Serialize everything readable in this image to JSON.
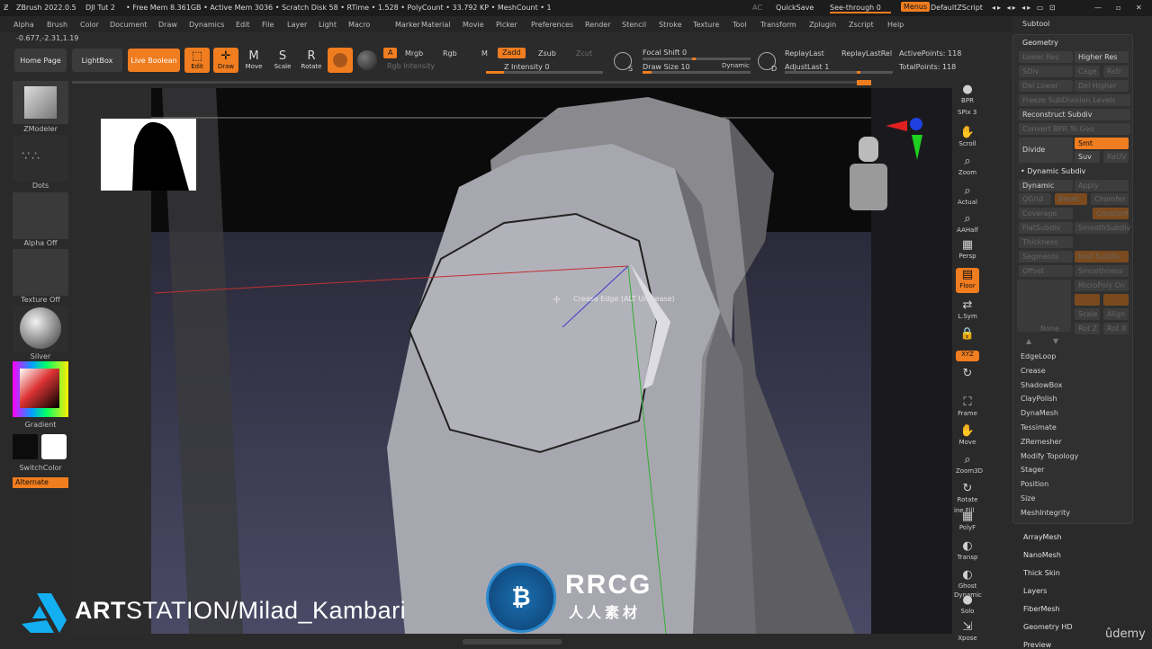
{
  "titlebar": {
    "app": "ZBrush 2022.0.5",
    "doc": "DJI Tut 2",
    "stats": "• Free Mem 8.361GB • Active Mem 3036 • Scratch Disk 58 • RTime • 1.528 • PolyCount • 33.792 KP • MeshCount • 1",
    "ac": "AC",
    "quicksave": "QuickSave",
    "seethrough": "See-through  0",
    "menus": "Menus",
    "script": "DefaultZScript"
  },
  "menubar": [
    "Alpha",
    "Brush",
    "Color",
    "Document",
    "Draw",
    "Dynamics",
    "Edit",
    "File",
    "Layer",
    "Light",
    "Macro",
    "Marker",
    "Material",
    "Movie",
    "Picker",
    "Preferences",
    "Render",
    "Stencil",
    "Stroke",
    "Texture",
    "Tool",
    "Transform",
    "Zplugin",
    "Zscript",
    "Help"
  ],
  "coords": "-0.677,-2.31,1.19",
  "toolbar": {
    "home": "Home Page",
    "lightbox": "LightBox",
    "liveboolean": "Live Boolean",
    "edit": "Edit",
    "draw": "Draw",
    "move": "Move",
    "scale": "Scale",
    "rotate": "Rotate",
    "a": "A",
    "mrgb": "Mrgb",
    "rgb": "Rgb",
    "m": "M",
    "zadd": "Zadd",
    "zsub": "Zsub",
    "zcut": "Zcut",
    "rgb_intensity": "Rgb Intensity",
    "z_intensity": "Z Intensity 0",
    "focal_shift": "Focal Shift 0",
    "draw_size": "Draw Size 10",
    "dynamic": "Dynamic",
    "replaylast": "ReplayLast",
    "replaylastrel": "ReplayLastRel",
    "adjustlast": "AdjustLast 1",
    "activepoints": "ActivePoints: 118",
    "totalpoints": "TotalPoints: 118",
    "s_letter": "S",
    "d_letter": "D"
  },
  "leftshelf": {
    "zmodeler": "ZModeler",
    "dots": "Dots",
    "alpha": "Alpha Off",
    "texture": "Texture Off",
    "material": "Silver",
    "gradient": "Gradient",
    "switchcolor": "SwitchColor",
    "alternate": "Alternate"
  },
  "rightshelf": [
    {
      "icon": "bpr-sphere-icon",
      "label": "BPR",
      "name": "bpr"
    },
    {
      "icon": "hand-scroll-icon",
      "label": "Scroll",
      "name": "scroll"
    },
    {
      "icon": "zoom-icon",
      "label": "Zoom",
      "name": "zoom"
    },
    {
      "icon": "actual-icon",
      "label": "Actual",
      "name": "actual"
    },
    {
      "icon": "aahalf-icon",
      "label": "AAHalf",
      "name": "aahalf"
    },
    {
      "icon": "persp-icon",
      "label": "Persp",
      "name": "persp"
    },
    {
      "icon": "floor-icon",
      "label": "Floor",
      "name": "floor"
    },
    {
      "icon": "lsym-icon",
      "label": "L.Sym",
      "name": "lsym"
    },
    {
      "icon": "lock-icon",
      "label": "",
      "name": "lock"
    },
    {
      "icon": "xyz-icon",
      "label": "XYZ",
      "name": "xyz"
    },
    {
      "icon": "rotate-axis-icon",
      "label": "",
      "name": "rotaxis"
    },
    {
      "icon": "frame-icon",
      "label": "Frame",
      "name": "frame"
    },
    {
      "icon": "move-icon",
      "label": "Move",
      "name": "move"
    },
    {
      "icon": "zoom3d-icon",
      "label": "Zoom3D",
      "name": "zoom3d"
    },
    {
      "icon": "rotate-icon",
      "label": "Rotate",
      "name": "rotate"
    },
    {
      "icon": "polyf-icon",
      "label": "PolyF",
      "name": "polyf"
    },
    {
      "icon": "transp-icon",
      "label": "Transp",
      "name": "transp"
    },
    {
      "icon": "ghost-icon",
      "label": "Ghost",
      "name": "ghost"
    },
    {
      "icon": "solo-icon",
      "label": "Solo",
      "name": "solo"
    },
    {
      "icon": "xpose-icon",
      "label": "Xpose",
      "name": "xpose"
    }
  ],
  "right_labels": {
    "spix": "SPix 3",
    "linefill": "ine Fill",
    "dynamic": "Dynamic"
  },
  "panel": {
    "subtool": "Subtool",
    "geometry": "Geometry",
    "lower_res": "Lower Res",
    "higher_res": "Higher Res",
    "sdiv": "SDiv",
    "cage": "Cage",
    "rstr": "Rstr",
    "del_lower": "Del Lower",
    "del_higher": "Del Higher",
    "freeze": "Freeze SubDivision Levels",
    "reconstruct": "Reconstruct Subdiv",
    "convert": "Convert BPR To Geo",
    "divide": "Divide",
    "smt": "Smt",
    "suv": "Suv",
    "reuv": "ReUV",
    "dynamic_subdiv": "Dynamic Subdiv",
    "dynamic": "Dynamic",
    "apply": "Apply",
    "qgrid": "QGrid",
    "bevel": "Bevel",
    "chamfer": "Chamfer",
    "coverage": "Coverage",
    "constant": "Constant",
    "flatsubdiv": "FlatSubdiv",
    "smoothsubdiv": "SmoothSubdiv",
    "thickness": "Thickness",
    "segments": "Segments",
    "postsubdiv": "Post SubDiv",
    "offset": "Offset",
    "smoothness": "Smoothness",
    "micropoly": "MicroPoly On",
    "none": "None",
    "scale": "Scale",
    "align": "Align",
    "rotz": "Rot Z",
    "rotx": "Rot X",
    "items": [
      "EdgeLoop",
      "Crease",
      "ShadowBox",
      "ClayPolish",
      "DynaMesh",
      "Tessimate",
      "ZRemesher",
      "Modify Topology",
      "Stager",
      "Position",
      "Size",
      "MeshIntegrity"
    ]
  },
  "below_panel": [
    "ArrayMesh",
    "NanoMesh",
    "Thick Skin",
    "Layers",
    "FiberMesh",
    "Geometry HD",
    "Preview"
  ],
  "tooltip": "Crease Edge (ALT Uncrease)",
  "watermark": {
    "artstation_bold": "ART",
    "artstation_rest": "STATION/Milad_Kambari",
    "rrcg": "RRCG",
    "rrcg_cn": "人人素材",
    "udemy": "ûdemy"
  },
  "colors": {
    "accent": "#f07d1f",
    "bg": "#2a2a2a",
    "viewport": "#1a1a1e"
  }
}
